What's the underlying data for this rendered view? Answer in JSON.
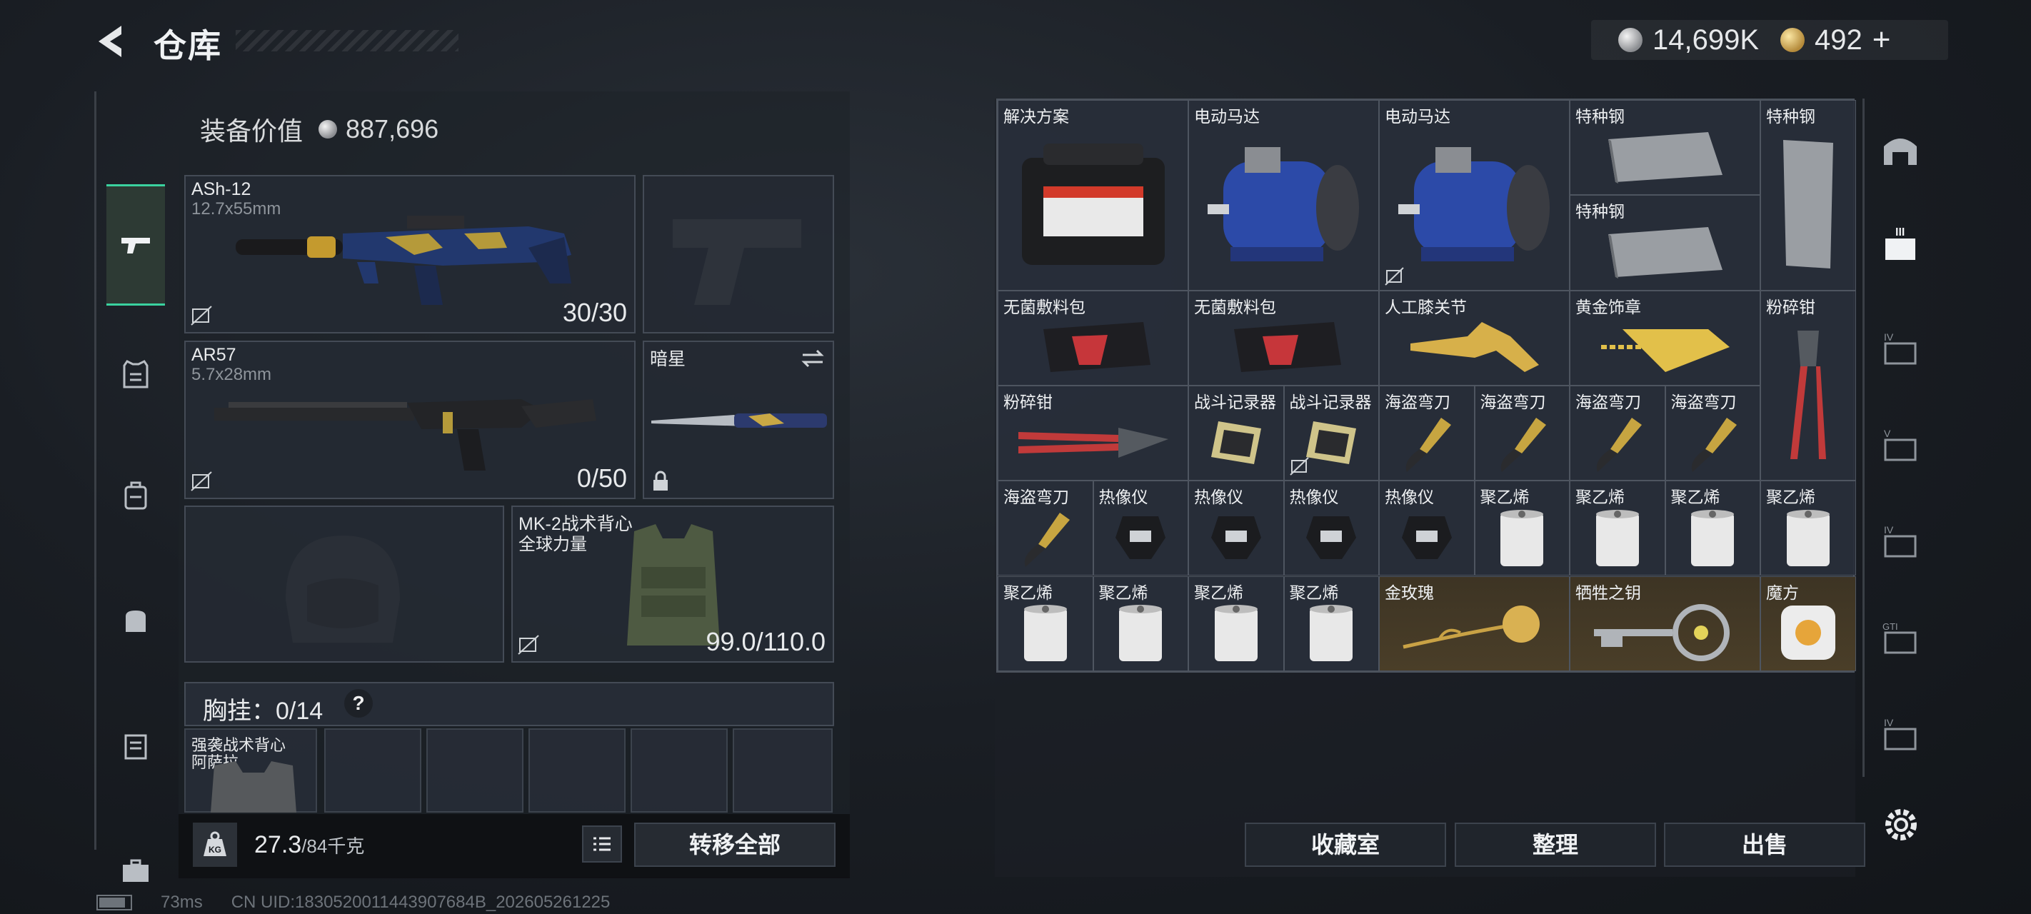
{
  "header": {
    "title": "仓库",
    "currency_silver": "14,699K",
    "currency_gold": "492",
    "currency_add": "+"
  },
  "nav": [
    "pistol-icon",
    "vest-icon",
    "backpack-icon",
    "bag-icon",
    "container-icon",
    "case-icon"
  ],
  "equipment": {
    "value_label": "装备价值",
    "value": "887,696",
    "primary": {
      "name": "ASh-12",
      "ammo": "12.7x55mm",
      "count": "30/30"
    },
    "secondary": {
      "name": "AR57",
      "ammo": "5.7x28mm",
      "count": "0/50"
    },
    "melee": {
      "name": "暗星"
    },
    "armor": {
      "name": "MK-2战术背心",
      "sub": "全球力量",
      "durability": "99.0/110.0"
    },
    "chest_label": "胸挂：",
    "chest_count": "0/14",
    "chest_help": "?",
    "chest_item": {
      "name": "强袭战术背心",
      "sub": "阿萨拉"
    }
  },
  "bottom": {
    "weight": "27.3",
    "weight_max": "/84千克",
    "weight_icon": "KG",
    "transfer_all": "转移全部"
  },
  "status": {
    "ping": "73ms",
    "uid": "CN UID:1830520011443907684B_202605261225"
  },
  "warehouse": {
    "items": [
      {
        "label": "解决方案",
        "icon": "toolbox"
      },
      {
        "label": "电动马达",
        "icon": "motor"
      },
      {
        "label": "电动马达",
        "icon": "motor"
      },
      {
        "label": "特种钢",
        "icon": "steel"
      },
      {
        "label": "特种钢",
        "icon": "steel-v"
      },
      {
        "label": "特种钢",
        "icon": "steel"
      },
      {
        "label": "无菌敷料包",
        "icon": "bandage"
      },
      {
        "label": "无菌敷料包",
        "icon": "bandage"
      },
      {
        "label": "人工膝关节",
        "icon": "knee"
      },
      {
        "label": "黄金饰章",
        "icon": "emblem"
      },
      {
        "label": "粉碎钳",
        "icon": "cutter-v"
      },
      {
        "label": "粉碎钳",
        "icon": "cutter"
      },
      {
        "label": "战斗记录器",
        "icon": "recorder"
      },
      {
        "label": "战斗记录器",
        "icon": "recorder"
      },
      {
        "label": "海盗弯刀",
        "icon": "knife"
      },
      {
        "label": "海盗弯刀",
        "icon": "knife"
      },
      {
        "label": "海盗弯刀",
        "icon": "knife"
      },
      {
        "label": "海盗弯刀",
        "icon": "knife"
      },
      {
        "label": "海盗弯刀",
        "icon": "knife"
      },
      {
        "label": "热像仪",
        "icon": "thermal"
      },
      {
        "label": "热像仪",
        "icon": "thermal"
      },
      {
        "label": "热像仪",
        "icon": "thermal"
      },
      {
        "label": "热像仪",
        "icon": "thermal"
      },
      {
        "label": "聚乙烯",
        "icon": "roll"
      },
      {
        "label": "聚乙烯",
        "icon": "roll"
      },
      {
        "label": "聚乙烯",
        "icon": "roll"
      },
      {
        "label": "聚乙烯",
        "icon": "roll"
      },
      {
        "label": "聚乙烯",
        "icon": "roll"
      },
      {
        "label": "聚乙烯",
        "icon": "roll"
      },
      {
        "label": "聚乙烯",
        "icon": "roll"
      },
      {
        "label": "聚乙烯",
        "icon": "roll"
      },
      {
        "label": "金玫瑰",
        "icon": "rose"
      },
      {
        "label": "牺牲之钥",
        "icon": "key"
      },
      {
        "label": "魔方",
        "icon": "cube"
      }
    ],
    "buttons": {
      "collection": "收藏室",
      "sort": "整理",
      "sell": "出售"
    }
  },
  "right_rail": [
    "base-icon",
    "tier-iii-icon",
    "tier-iv-icon",
    "tier-v-icon",
    "tier-iv-b-icon",
    "gti-icon",
    "tier-iv-c-icon"
  ]
}
